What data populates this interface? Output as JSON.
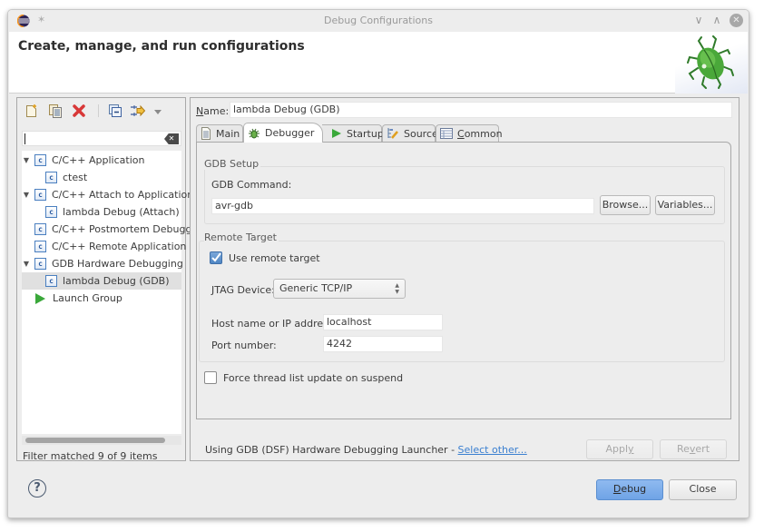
{
  "window": {
    "title": "Debug Configurations",
    "controls": [
      "minimize",
      "maximize",
      "close"
    ]
  },
  "header": {
    "title": "Create, manage, and run configurations",
    "banner_icon": "bug-icon"
  },
  "left_panel": {
    "toolbar": [
      {
        "name": "new-configuration",
        "icon": "new-document-icon"
      },
      {
        "name": "duplicate",
        "icon": "duplicate-icon"
      },
      {
        "name": "delete",
        "icon": "delete-icon"
      },
      {
        "name": "collapse-all",
        "icon": "collapse-all-icon"
      },
      {
        "name": "filter",
        "icon": "filter-icon"
      },
      {
        "name": "view-menu",
        "icon": "dropdown-arrow-icon"
      }
    ],
    "filter": {
      "value": "",
      "placeholder": ""
    },
    "tree": [
      {
        "label": "C/C++ Application",
        "level": 0,
        "expanded": true,
        "icon": "c-icon"
      },
      {
        "label": "ctest",
        "level": 1,
        "icon": "c-icon"
      },
      {
        "label": "C/C++ Attach to Application",
        "level": 0,
        "expanded": true,
        "icon": "c-icon"
      },
      {
        "label": "lambda Debug (Attach)",
        "level": 1,
        "icon": "c-icon"
      },
      {
        "label": "C/C++ Postmortem Debugger",
        "level": 0,
        "icon": "c-icon"
      },
      {
        "label": "C/C++ Remote Application",
        "level": 0,
        "icon": "c-icon"
      },
      {
        "label": "GDB Hardware Debugging",
        "level": 0,
        "expanded": true,
        "icon": "c-icon"
      },
      {
        "label": "lambda Debug (GDB)",
        "level": 1,
        "icon": "c-icon",
        "selected": true
      },
      {
        "label": "Launch Group",
        "level": 0,
        "icon": "play-icon"
      }
    ],
    "status": "Filter matched 9 of 9 items"
  },
  "right_panel": {
    "name_label_accel": "N",
    "name_label_rest": "ame:",
    "name_value": "lambda Debug (GDB)",
    "tabs": [
      {
        "label": "Main",
        "icon": "document-icon",
        "active": false
      },
      {
        "label": "Debugger",
        "icon": "bug-icon",
        "active": true
      },
      {
        "label": "Startup",
        "icon": "play-icon",
        "active": false
      },
      {
        "label": "Source",
        "icon": "source-icon",
        "active": false
      },
      {
        "label": "Common",
        "icon": "table-icon",
        "active": false,
        "accel": "C"
      }
    ],
    "gdb_setup": {
      "group_label": "GDB Setup",
      "command_label": "GDB Command:",
      "command_value": "avr-gdb",
      "browse_label": "Browse...",
      "variables_label": "Variables..."
    },
    "remote_target": {
      "group_label": "Remote Target",
      "use_remote_label": "Use remote target",
      "use_remote_checked": true,
      "jtag_label": "JTAG Device:",
      "jtag_value": "Generic TCP/IP",
      "host_label": "Host name or IP address:",
      "host_value": "localhost",
      "port_label": "Port number:",
      "port_value": "4242"
    },
    "force_thread_label": "Force thread list update on suspend",
    "force_thread_checked": false,
    "launcher_text": "Using GDB (DSF) Hardware Debugging Launcher - ",
    "launcher_link": "Select other...",
    "apply_label": "Apply",
    "revert_label": "Revert"
  },
  "footer": {
    "help_icon": "help-icon",
    "debug_label": "Debug",
    "close_label": "Close"
  }
}
